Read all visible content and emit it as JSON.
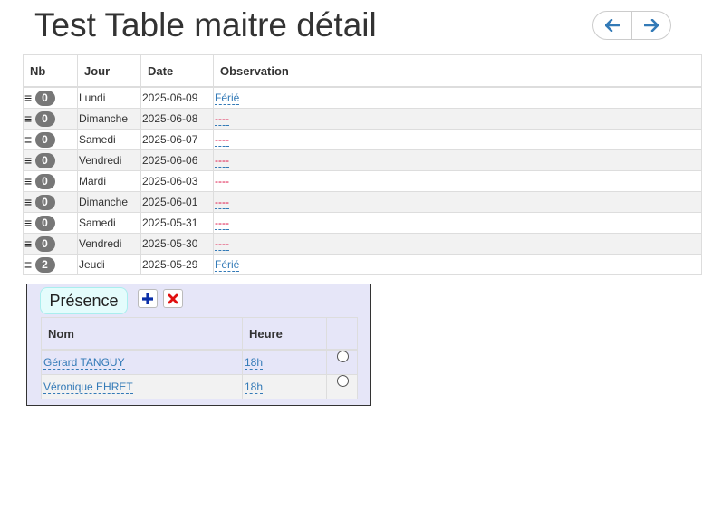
{
  "title": "Test Table maitre détail",
  "nav": {
    "prev_icon": "arrow-left-icon",
    "next_icon": "arrow-right-icon"
  },
  "master": {
    "headers": {
      "nb": "Nb",
      "jour": "Jour",
      "date": "Date",
      "observation": "Observation"
    },
    "rows": [
      {
        "count": "0",
        "jour": "Lundi",
        "date": "2025-06-09",
        "observation": "Férié",
        "empty": false
      },
      {
        "count": "0",
        "jour": "Dimanche",
        "date": "2025-06-08",
        "observation": "----",
        "empty": true
      },
      {
        "count": "0",
        "jour": "Samedi",
        "date": "2025-06-07",
        "observation": "----",
        "empty": true
      },
      {
        "count": "0",
        "jour": "Vendredi",
        "date": "2025-06-06",
        "observation": "----",
        "empty": true
      },
      {
        "count": "0",
        "jour": "Mardi",
        "date": "2025-06-03",
        "observation": "----",
        "empty": true
      },
      {
        "count": "0",
        "jour": "Dimanche",
        "date": "2025-06-01",
        "observation": "----",
        "empty": true
      },
      {
        "count": "0",
        "jour": "Samedi",
        "date": "2025-05-31",
        "observation": "----",
        "empty": true
      },
      {
        "count": "0",
        "jour": "Vendredi",
        "date": "2025-05-30",
        "observation": "----",
        "empty": true
      },
      {
        "count": "2",
        "jour": "Jeudi",
        "date": "2025-05-29",
        "observation": "Férié",
        "empty": false
      }
    ]
  },
  "detail": {
    "tab_label": "Présence",
    "add_icon": "plus-icon",
    "delete_icon": "close-icon",
    "headers": {
      "nom": "Nom",
      "heure": "Heure"
    },
    "rows": [
      {
        "nom": "Gérard TANGUY",
        "heure": "18h"
      },
      {
        "nom": "Véronique EHRET",
        "heure": "18h"
      }
    ]
  },
  "colors": {
    "link": "#337ab7",
    "empty_link": "#dd1144",
    "badge": "#777777",
    "detail_bg": "#e6e6f8",
    "tab_bg": "#e4fcfc"
  }
}
